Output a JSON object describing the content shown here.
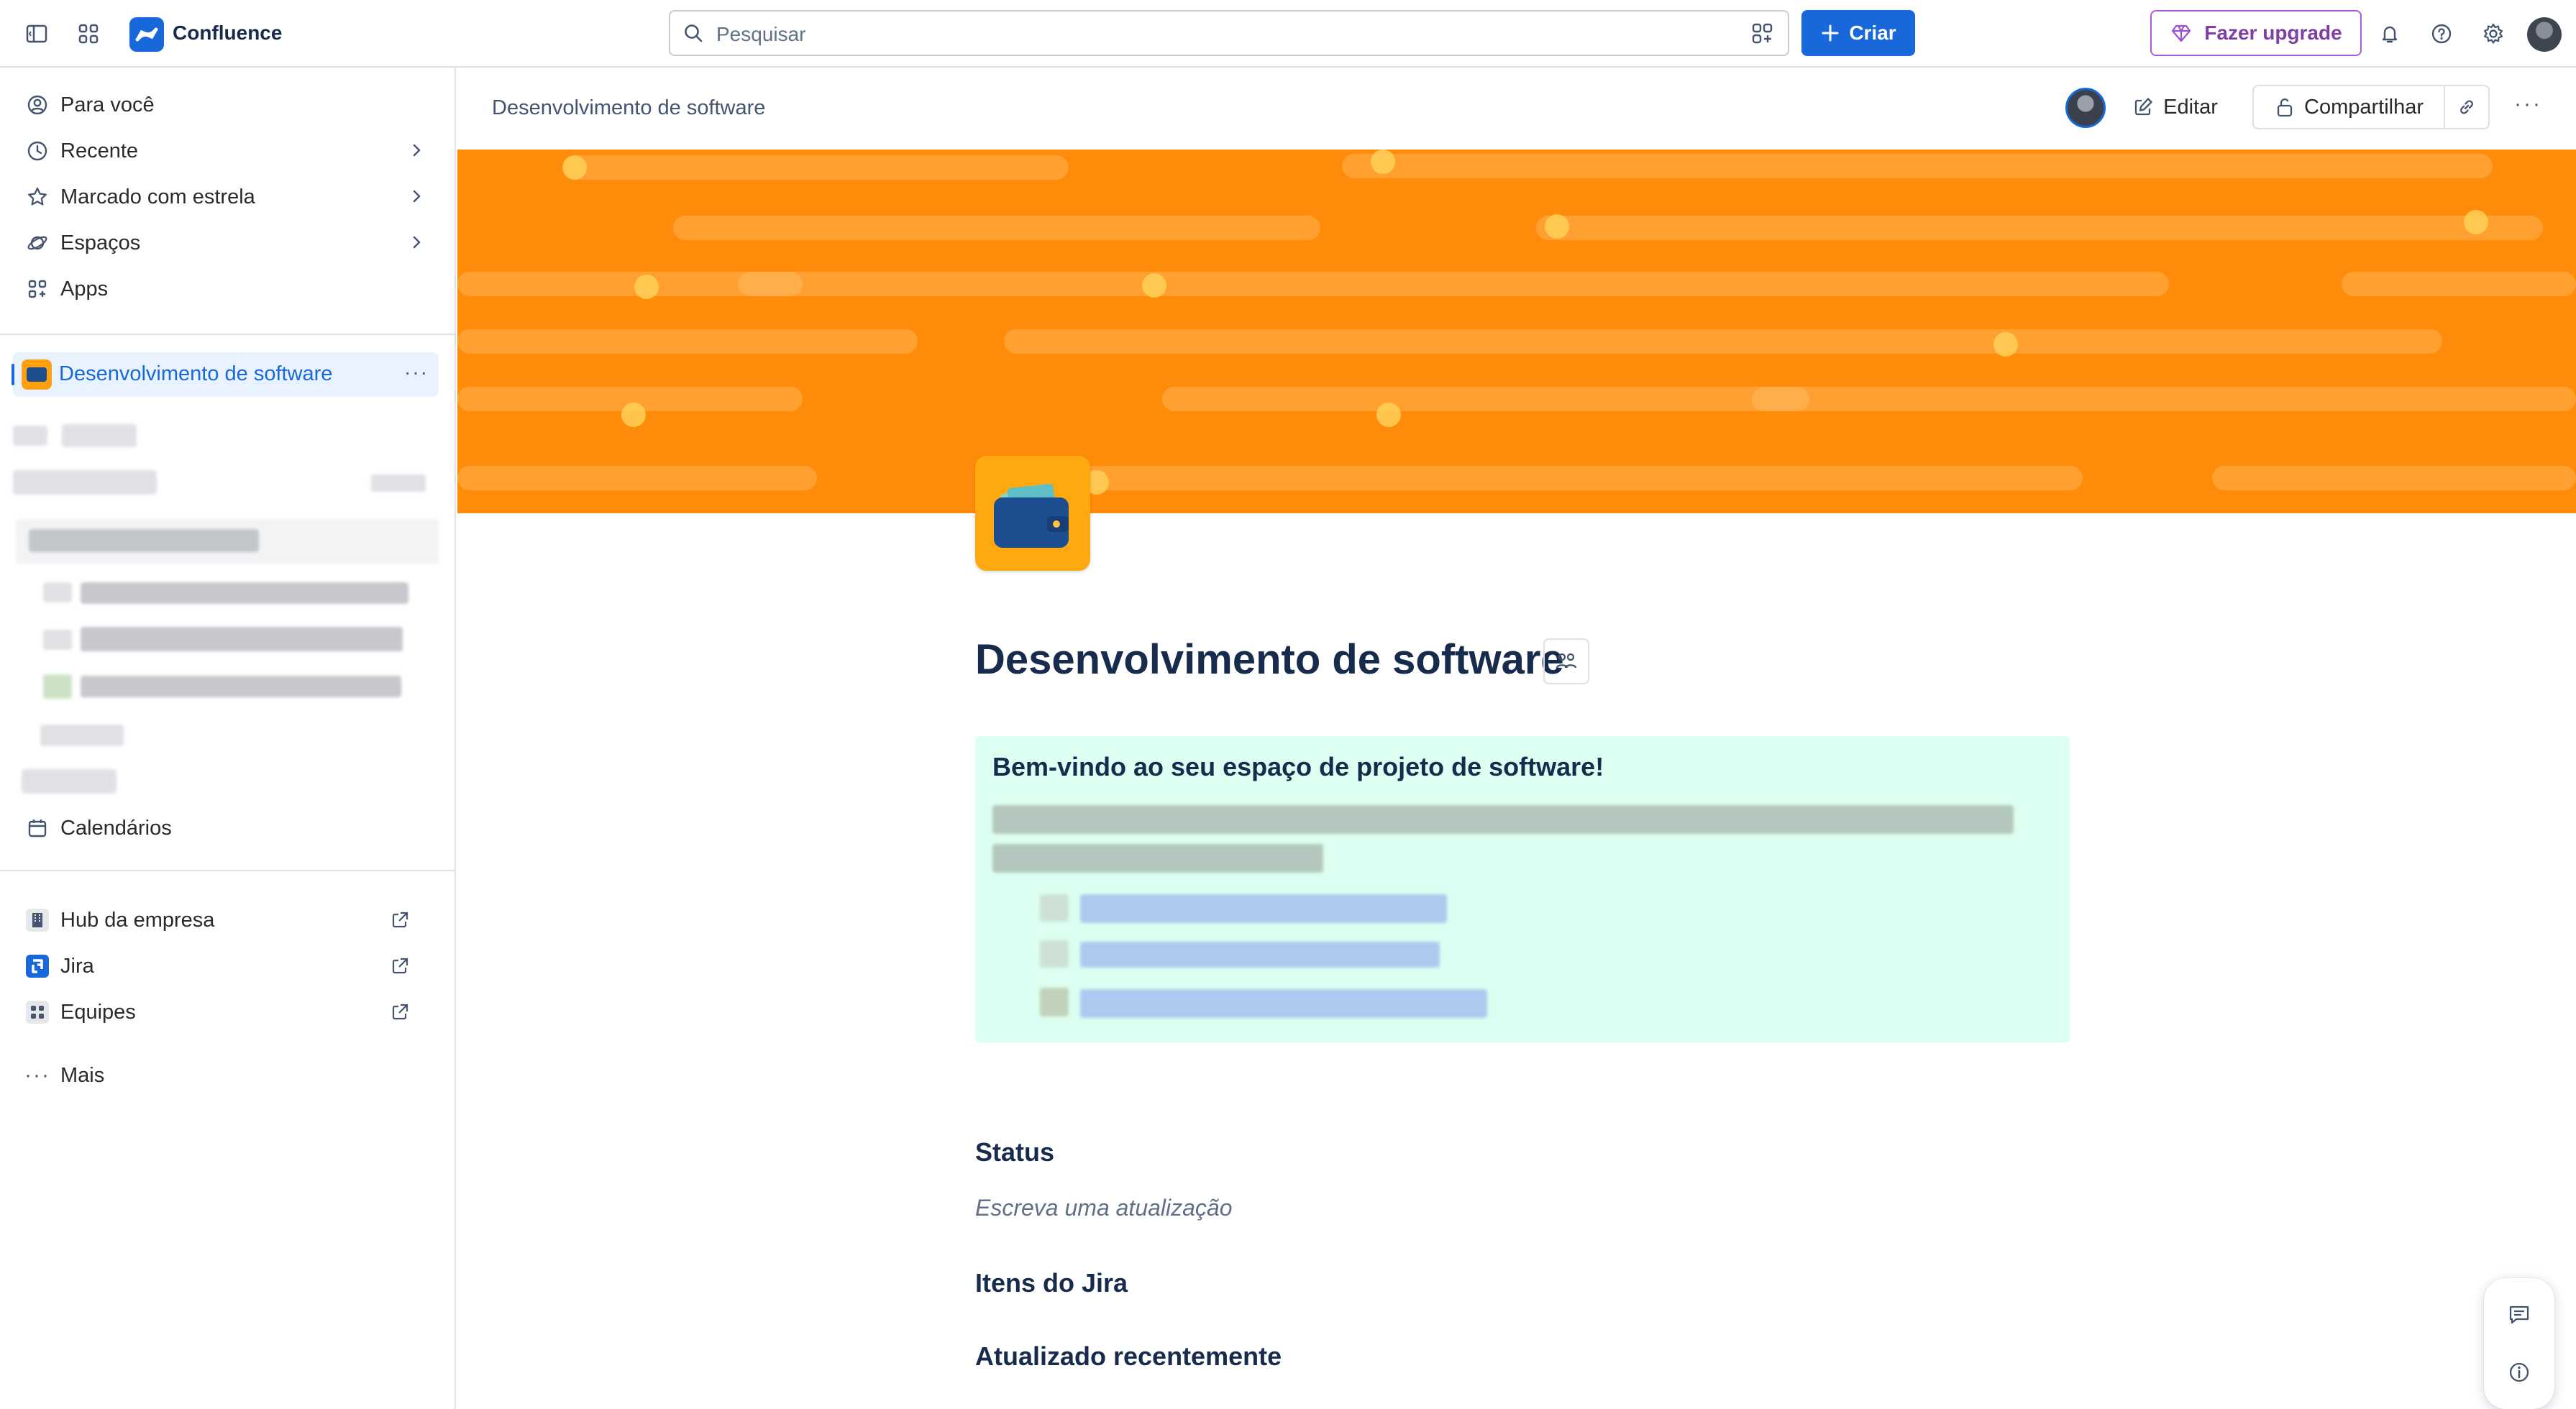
{
  "topbar": {
    "app_name": "Confluence",
    "search_placeholder": "Pesquisar",
    "create_label": "Criar",
    "upgrade_label": "Fazer upgrade",
    "icons": [
      "sidebar-toggle-icon",
      "app-switcher-icon",
      "confluence-logo-icon",
      "search-icon",
      "rovo-icon",
      "plus-icon",
      "gem-icon",
      "bell-icon",
      "help-icon",
      "settings-icon"
    ]
  },
  "sidebar": {
    "nav": [
      {
        "label": "Para você",
        "icon": "user-circle-icon"
      },
      {
        "label": "Recente",
        "icon": "clock-icon"
      },
      {
        "label": "Marcado com estrela",
        "icon": "star-icon"
      },
      {
        "label": "Espaços",
        "icon": "planet-icon"
      },
      {
        "label": "Apps",
        "icon": "apps-icon"
      }
    ],
    "space_label": "Desenvolvimento de software",
    "space_more": "···",
    "calendars_label": "Calendários",
    "external": [
      {
        "label": "Hub da empresa",
        "icon": "building-icon"
      },
      {
        "label": "Jira",
        "icon": "jira-icon"
      },
      {
        "label": "Equipes",
        "icon": "teams-icon"
      }
    ],
    "more_label": "Mais",
    "more_icon": "···"
  },
  "main": {
    "breadcrumb": "Desenvolvimento de software",
    "edit_label": "Editar",
    "share_label": "Compartilhar",
    "more_icon": "···",
    "page_title": "Desenvolvimento de software",
    "panel_title": "Bem-vindo ao seu espaço de projeto de software!",
    "sections": {
      "status_heading": "Status",
      "status_placeholder": "Escreva uma atualização",
      "jira_heading": "Itens do Jira",
      "recent_heading": "Atualizado recentemente"
    }
  },
  "colors": {
    "brand_blue": "#1868db",
    "banner_orange": "#ff8b0a",
    "panel_green": "#dcfff1",
    "upgrade_purple": "#803fa5"
  }
}
